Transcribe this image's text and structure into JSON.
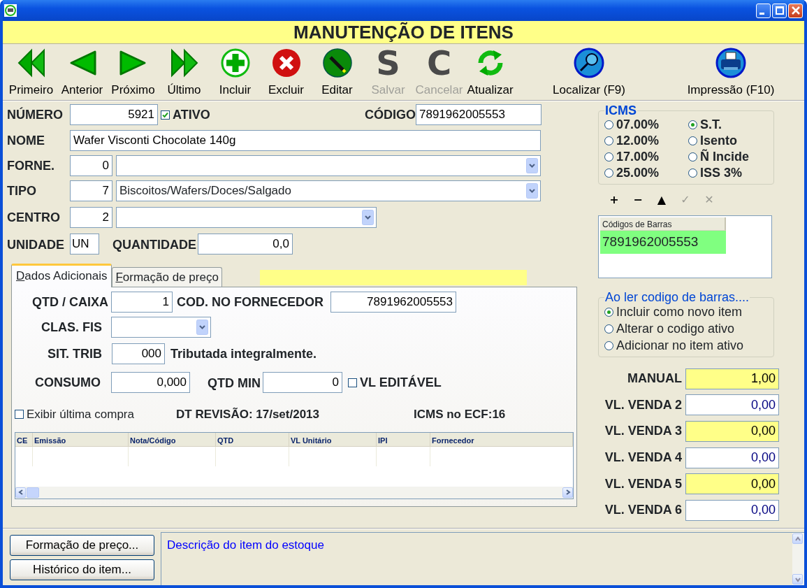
{
  "header": {
    "title": "MANUTENÇÃO DE ITENS"
  },
  "toolbar": [
    {
      "label": "Primeiro",
      "kind": "first",
      "disabled": false
    },
    {
      "label": "Anterior",
      "kind": "prev",
      "disabled": false
    },
    {
      "label": "Próximo",
      "kind": "next",
      "disabled": false
    },
    {
      "label": "Último",
      "kind": "last",
      "disabled": false
    },
    {
      "label": "Incluir",
      "kind": "add",
      "disabled": false
    },
    {
      "label": "Excluir",
      "kind": "delete",
      "disabled": false
    },
    {
      "label": "Editar",
      "kind": "edit",
      "disabled": false
    },
    {
      "label": "Salvar",
      "kind": "glyph",
      "glyph": "S",
      "disabled": true
    },
    {
      "label": "Cancelar",
      "kind": "glyph",
      "glyph": "C",
      "disabled": true
    },
    {
      "label": "Atualizar",
      "kind": "refresh",
      "disabled": false
    },
    {
      "label": "Localizar (F9)",
      "kind": "search",
      "disabled": false
    },
    {
      "label": "Impressão (F10)",
      "kind": "print",
      "disabled": false
    }
  ],
  "item": {
    "number": {
      "label": "NÚMERO",
      "value": "5921"
    },
    "active": {
      "label": "ATIVO",
      "checked": true
    },
    "code": {
      "label": "CÓDIGO",
      "value": "7891962005553"
    },
    "name": {
      "label": "NOME",
      "value": "Wafer Visconti Chocolate 140g"
    },
    "supplier": {
      "label": "FORNE.",
      "id": "0"
    },
    "type": {
      "label": "TIPO",
      "id": "7",
      "value": "Biscoitos/Wafers/Doces/Salgado"
    },
    "center": {
      "label": "CENTRO",
      "id": "2"
    },
    "unit": {
      "label": "UNIDADE",
      "value": "UN"
    },
    "quantity": {
      "label": "QUANTIDADE",
      "value": "0,0"
    }
  },
  "tabs": [
    {
      "label": "Dados Adicionais",
      "selected": true
    },
    {
      "label": "Formação de preço",
      "selected": false
    }
  ],
  "details": {
    "qty_box": {
      "label": "QTD / CAIXA",
      "value": "1"
    },
    "supplier_code": {
      "label": "COD. NO FORNECEDOR",
      "value": "7891962005553"
    },
    "fiscal_class": {
      "label": "CLAS. FIS"
    },
    "tax_situation": {
      "label": "SIT. TRIB",
      "value": "000",
      "description": "Tributada integralmente."
    },
    "consumption": {
      "label": "CONSUMO",
      "value": "0,000"
    },
    "min_qty": {
      "label": "QTD MIN",
      "value": "0"
    },
    "editable": {
      "label": "VL EDITÁVEL",
      "checked": false
    },
    "show_last_purchase": {
      "label": "Exibir última compra",
      "checked": false
    },
    "revision": "DT REVISÃO: 17/set/2013",
    "ecf": "ICMS no ECF:16"
  },
  "purchases_table": {
    "columns": [
      "CE",
      "Emissão",
      "Nota/Código",
      "QTD",
      "VL Unitário",
      "IPI",
      "Fornecedor"
    ]
  },
  "icms": {
    "title": "ICMS",
    "options": [
      {
        "label": "07.00%",
        "selected": false
      },
      {
        "label": "12.00%",
        "selected": false
      },
      {
        "label": "17.00%",
        "selected": false
      },
      {
        "label": "25.00%",
        "selected": false
      },
      {
        "label": "S.T.",
        "selected": true
      },
      {
        "label": "Isento",
        "selected": false
      },
      {
        "label": "Ñ Incide",
        "selected": false
      },
      {
        "label": "ISS 3%",
        "selected": false
      }
    ]
  },
  "barcode_tools": [
    {
      "symbol": "+",
      "disabled": false
    },
    {
      "symbol": "−",
      "disabled": false
    },
    {
      "symbol": "▲",
      "disabled": false
    },
    {
      "symbol": "✓",
      "disabled": true
    },
    {
      "symbol": "✕",
      "disabled": true
    }
  ],
  "barcodes": {
    "column": "Códigos de Barras",
    "rows": [
      {
        "code": "7891962005553",
        "selected": true
      }
    ]
  },
  "scan_action": {
    "title": "Ao ler codigo de barras....",
    "options": [
      {
        "label": "Incluir como novo item",
        "selected": true
      },
      {
        "label": "Alterar o codigo ativo",
        "selected": false
      },
      {
        "label": "Adicionar no item ativo",
        "selected": false
      }
    ]
  },
  "prices": [
    {
      "label": "MANUAL",
      "value": "1,00",
      "highlighted": true
    },
    {
      "label": "VL. VENDA 2",
      "value": "0,00",
      "highlighted": false
    },
    {
      "label": "VL. VENDA 3",
      "value": "0,00",
      "highlighted": true
    },
    {
      "label": "VL. VENDA 4",
      "value": "0,00",
      "highlighted": false
    },
    {
      "label": "VL. VENDA 5",
      "value": "0,00",
      "highlighted": true
    },
    {
      "label": "VL. VENDA 6",
      "value": "0,00",
      "highlighted": false
    }
  ],
  "bottom_buttons": [
    "Formação de preço...",
    "Histórico do item..."
  ],
  "description": "Descrição do item do estoque"
}
